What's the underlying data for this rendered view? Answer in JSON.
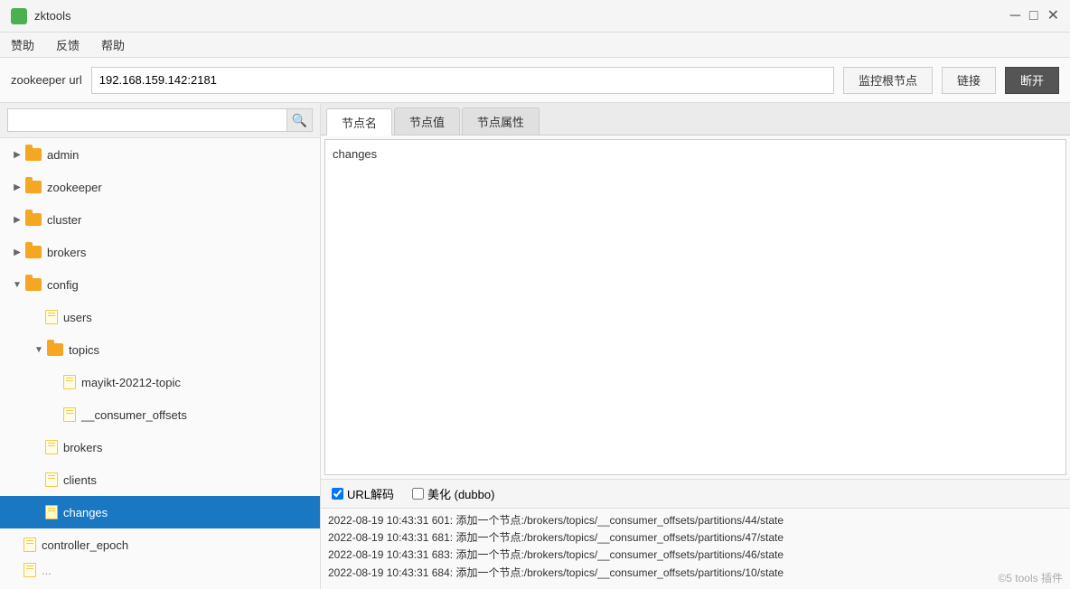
{
  "app": {
    "title": "zktools",
    "icon_color": "#4caf50"
  },
  "title_controls": {
    "minimize": "─",
    "maximize": "□",
    "close": "✕"
  },
  "menu": {
    "items": [
      "赞助",
      "反馈",
      "帮助"
    ]
  },
  "toolbar": {
    "label": "zookeeper url",
    "url_value": "192.168.159.142:2181",
    "url_placeholder": "192.168.159.142:2181",
    "monitor_btn": "监控根节点",
    "connect_btn": "链接",
    "disconnect_btn": "断开"
  },
  "tabs": {
    "items": [
      "节点名",
      "节点值",
      "节点属性"
    ],
    "active": 0
  },
  "node_value": {
    "content": "changes"
  },
  "bottom_options": {
    "url_decode_label": "URL解码",
    "url_decode_checked": true,
    "beautify_label": "美化 (dubbo)",
    "beautify_checked": false
  },
  "tree": {
    "items": [
      {
        "id": "admin",
        "label": "admin",
        "type": "folder",
        "level": 1,
        "expanded": false,
        "selected": false
      },
      {
        "id": "zookeeper",
        "label": "zookeeper",
        "type": "folder",
        "level": 1,
        "expanded": false,
        "selected": false
      },
      {
        "id": "cluster",
        "label": "cluster",
        "type": "folder",
        "level": 1,
        "expanded": false,
        "selected": false
      },
      {
        "id": "brokers",
        "label": "brokers",
        "type": "folder",
        "level": 1,
        "expanded": false,
        "selected": false
      },
      {
        "id": "config",
        "label": "config",
        "type": "folder",
        "level": 1,
        "expanded": true,
        "selected": false
      },
      {
        "id": "users",
        "label": "users",
        "type": "file",
        "level": 2,
        "selected": false
      },
      {
        "id": "topics",
        "label": "topics",
        "type": "folder",
        "level": 2,
        "expanded": true,
        "selected": false
      },
      {
        "id": "mayikt-20212-topic",
        "label": "mayikt-20212-topic",
        "type": "file",
        "level": 3,
        "selected": false
      },
      {
        "id": "__consumer_offsets",
        "label": "__consumer_offsets",
        "type": "file",
        "level": 3,
        "selected": false
      },
      {
        "id": "brokers2",
        "label": "brokers",
        "type": "file",
        "level": 2,
        "selected": false
      },
      {
        "id": "clients",
        "label": "clients",
        "type": "file",
        "level": 2,
        "selected": false
      },
      {
        "id": "changes",
        "label": "changes",
        "type": "file",
        "level": 2,
        "selected": true
      },
      {
        "id": "controller_epoch",
        "label": "controller_epoch",
        "type": "file",
        "level": 1,
        "selected": false
      },
      {
        "id": "last_item",
        "label": "...",
        "type": "file",
        "level": 1,
        "selected": false
      }
    ]
  },
  "log": {
    "lines": [
      "2022-08-19 10:43:31 601: 添加一个节点:/brokers/topics/__consumer_offsets/partitions/44/state",
      "2022-08-19 10:43:31 681: 添加一个节点:/brokers/topics/__consumer_offsets/partitions/47/state",
      "2022-08-19 10:43:31 683: 添加一个节点:/brokers/topics/__consumer_offsets/partitions/46/state",
      "2022-08-19 10:43:31 684: 添加一个节点:/brokers/topics/__consumer_offsets/partitions/10/state"
    ],
    "watermark": "©5 tools 插件"
  }
}
